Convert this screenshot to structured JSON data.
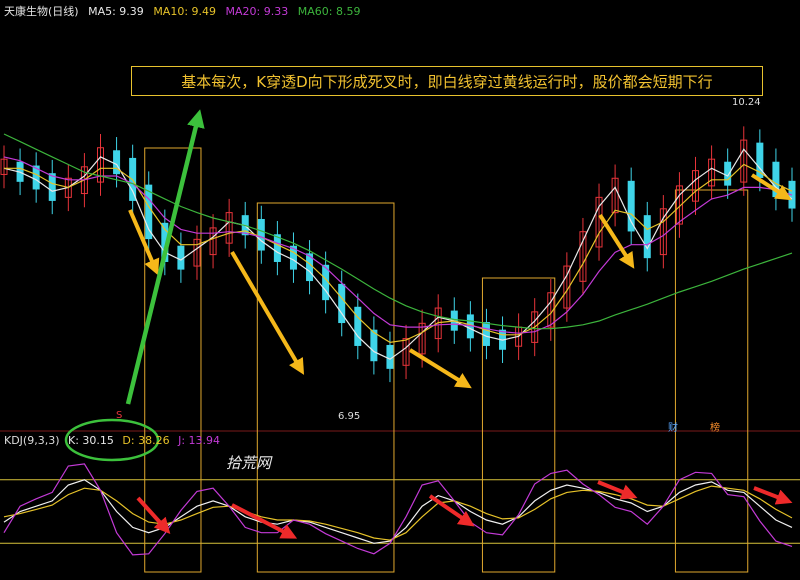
{
  "header": {
    "stock": "天康生物(日线)",
    "ma5": "MA5: 9.39",
    "ma10": "MA10: 9.49",
    "ma20": "MA20: 9.33",
    "ma60": "MA60: 8.59"
  },
  "annotation": "基本每次，K穿透D向下形成死叉时，即白线穿过黄线运行时，股价都会短期下行",
  "price_labels": {
    "high": "10.24",
    "low": "6.95"
  },
  "kdj_header": {
    "name": "KDJ(9,3,3)",
    "k": "K: 30.15",
    "d": "D: 38.26",
    "j": "J: 13.94"
  },
  "badges": {
    "cai": "财",
    "bang": "榜"
  },
  "marker_s": "S",
  "watermark": "拾荒网",
  "colors": {
    "up": "#e8343a",
    "down": "#3fd4e8",
    "ma5": "#e8e8e8",
    "ma10": "#e6c229",
    "ma20": "#c33ad6",
    "ma60": "#3cb43c",
    "box": "#e0a82e",
    "arrow_yellow": "#f5b81a",
    "arrow_red": "#ee2a2a",
    "arrow_green": "#3cc13c"
  },
  "chart_data": {
    "type": "candlestick",
    "price_range": [
      6.6,
      10.7
    ],
    "kdj_range": [
      -10,
      110
    ],
    "kdj_levels": [
      80,
      20
    ],
    "ma_series": {
      "ma5": [
        9.7,
        9.65,
        9.55,
        9.4,
        9.45,
        9.6,
        9.85,
        9.75,
        9.4,
        8.9,
        8.6,
        8.5,
        8.65,
        8.8,
        9.0,
        8.95,
        8.75,
        8.6,
        8.5,
        8.35,
        8.1,
        7.8,
        7.5,
        7.3,
        7.2,
        7.35,
        7.55,
        7.75,
        7.7,
        7.6,
        7.5,
        7.45,
        7.5,
        7.7,
        7.95,
        8.3,
        8.75,
        9.2,
        9.45,
        9.0,
        8.65,
        9.05,
        9.35,
        9.55,
        9.7,
        9.6,
        9.95,
        9.7,
        9.45,
        9.3
      ],
      "ma10": [
        9.7,
        9.7,
        9.62,
        9.5,
        9.45,
        9.55,
        9.7,
        9.7,
        9.55,
        9.2,
        8.9,
        8.7,
        8.7,
        8.78,
        8.85,
        8.88,
        8.8,
        8.7,
        8.6,
        8.45,
        8.25,
        8.0,
        7.75,
        7.55,
        7.42,
        7.45,
        7.55,
        7.68,
        7.7,
        7.65,
        7.58,
        7.52,
        7.52,
        7.62,
        7.8,
        8.1,
        8.45,
        8.85,
        9.15,
        9.1,
        8.9,
        9.0,
        9.2,
        9.4,
        9.55,
        9.55,
        9.75,
        9.65,
        9.5,
        9.4
      ],
      "ma20": [
        9.85,
        9.8,
        9.7,
        9.6,
        9.55,
        9.55,
        9.6,
        9.6,
        9.5,
        9.3,
        9.05,
        8.9,
        8.85,
        8.85,
        8.87,
        8.85,
        8.8,
        8.72,
        8.65,
        8.55,
        8.4,
        8.2,
        8.0,
        7.8,
        7.65,
        7.62,
        7.62,
        7.65,
        7.66,
        7.64,
        7.6,
        7.56,
        7.54,
        7.56,
        7.65,
        7.82,
        8.05,
        8.35,
        8.6,
        8.7,
        8.7,
        8.82,
        9.0,
        9.15,
        9.3,
        9.35,
        9.45,
        9.45,
        9.42,
        9.35
      ],
      "ma60": [
        10.15,
        10.05,
        9.95,
        9.85,
        9.75,
        9.65,
        9.6,
        9.55,
        9.5,
        9.4,
        9.3,
        9.2,
        9.12,
        9.05,
        9.0,
        8.95,
        8.88,
        8.8,
        8.72,
        8.62,
        8.5,
        8.38,
        8.25,
        8.12,
        8.0,
        7.9,
        7.82,
        7.76,
        7.72,
        7.7,
        7.67,
        7.64,
        7.62,
        7.6,
        7.6,
        7.62,
        7.65,
        7.7,
        7.78,
        7.85,
        7.92,
        8.0,
        8.08,
        8.15,
        8.22,
        8.3,
        8.38,
        8.45,
        8.52,
        8.59
      ]
    },
    "kdj_series": {
      "K": [
        40,
        50,
        55,
        60,
        75,
        80,
        70,
        50,
        35,
        30,
        35,
        45,
        55,
        60,
        55,
        45,
        40,
        38,
        42,
        40,
        35,
        30,
        25,
        20,
        22,
        35,
        55,
        65,
        60,
        50,
        42,
        38,
        45,
        60,
        70,
        75,
        72,
        68,
        62,
        58,
        50,
        55,
        68,
        75,
        78,
        70,
        68,
        55,
        42,
        35
      ],
      "D": [
        45,
        48,
        52,
        56,
        66,
        72,
        70,
        60,
        48,
        40,
        38,
        42,
        48,
        54,
        55,
        50,
        45,
        42,
        42,
        41,
        38,
        34,
        30,
        25,
        23,
        30,
        45,
        58,
        60,
        55,
        48,
        43,
        44,
        52,
        62,
        68,
        70,
        69,
        66,
        62,
        56,
        55,
        62,
        69,
        74,
        72,
        70,
        62,
        52,
        44
      ],
      "J": [
        30,
        55,
        62,
        68,
        93,
        95,
        70,
        30,
        9,
        10,
        29,
        51,
        69,
        72,
        55,
        35,
        30,
        30,
        42,
        38,
        29,
        22,
        15,
        10,
        20,
        45,
        75,
        79,
        60,
        40,
        30,
        28,
        47,
        76,
        86,
        89,
        76,
        66,
        54,
        50,
        38,
        55,
        80,
        87,
        86,
        66,
        64,
        41,
        22,
        17
      ]
    },
    "sell_windows": [
      [
        9,
        12
      ],
      [
        16,
        24
      ],
      [
        30,
        34
      ],
      [
        42,
        46
      ],
      [
        56,
        59
      ]
    ]
  }
}
